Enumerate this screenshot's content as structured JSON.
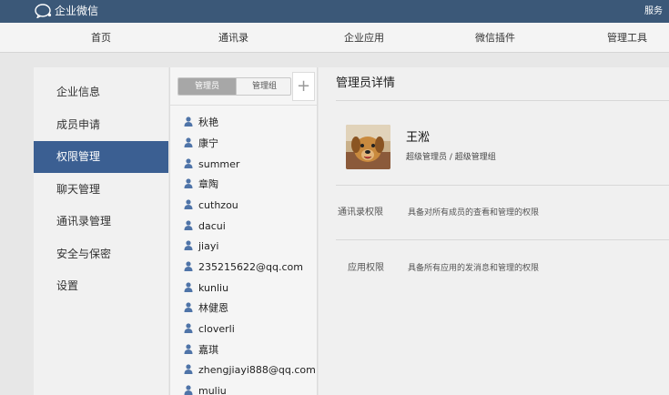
{
  "app": {
    "title": "企业微信",
    "service_link": "服务"
  },
  "nav": {
    "items": [
      "首页",
      "通讯录",
      "企业应用",
      "微信插件",
      "管理工具"
    ]
  },
  "sidebar": {
    "items": [
      "企业信息",
      "成员申请",
      "权限管理",
      "聊天管理",
      "通讯录管理",
      "安全与保密",
      "设置"
    ],
    "active_index": 2
  },
  "members": {
    "tabs": [
      "管理员",
      "管理组"
    ],
    "add_label": "+",
    "list": [
      "秋艳",
      "康宁",
      "summer",
      "章陶",
      "cuthzou",
      "dacui",
      "jiayi",
      "235215622@qq.com",
      "kunliu",
      "林健恩",
      "cloverli",
      "嘉琪",
      "zhengjiayi888@qq.com",
      "muliu"
    ]
  },
  "detail": {
    "title": "管理员详情",
    "name": "王淞",
    "role": "超级管理员 / 超级管理组",
    "permissions": [
      {
        "label": "通讯录权限",
        "desc": "具备对所有成员的查看和管理的权限"
      },
      {
        "label": "应用权限",
        "desc": "具备所有应用的发消息和管理的权限"
      }
    ]
  },
  "colors": {
    "header": "#3b5878",
    "active": "#3b5f92",
    "person_icon": "#4f74a8"
  }
}
